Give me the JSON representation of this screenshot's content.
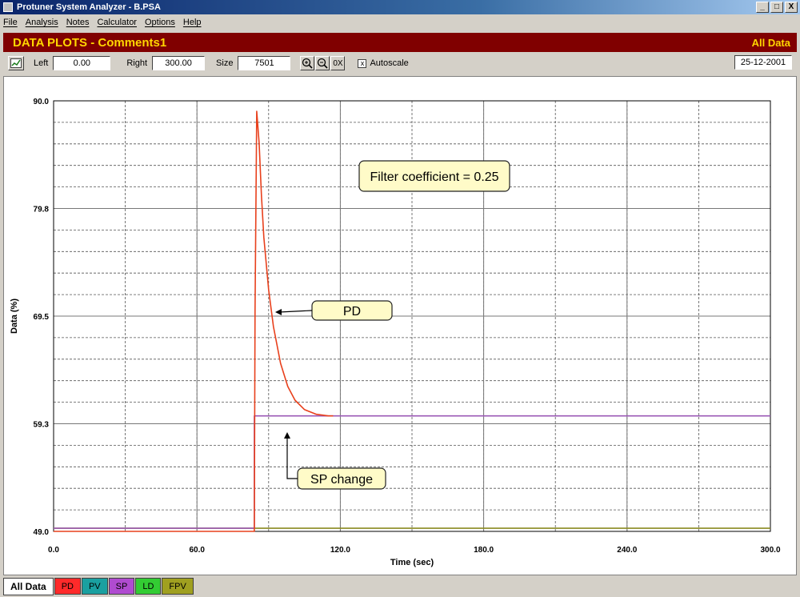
{
  "window": {
    "title": "Protuner System Analyzer - B.PSA",
    "min": "_",
    "max": "□",
    "close": "X"
  },
  "menu": [
    "File",
    "Analysis",
    "Notes",
    "Calculator",
    "Options",
    "Help"
  ],
  "header": {
    "title": "DATA PLOTS - Comments1",
    "right": "All Data"
  },
  "toolbar": {
    "left_label": "Left",
    "left_value": "0.00",
    "right_label": "Right",
    "right_value": "300.00",
    "size_label": "Size",
    "size_value": "7501",
    "zoom_in": "+",
    "zoom_out": "−",
    "zoom_reset": "0X",
    "autoscale_label": "Autoscale",
    "autoscale_checked": "x",
    "date": "25-12-2001"
  },
  "chart_data": {
    "type": "line",
    "xlabel": "Time (sec)",
    "ylabel": "Data (%)",
    "xlim": [
      0,
      300
    ],
    "ylim": [
      49.0,
      90.0
    ],
    "xticks": [
      "0.0",
      "60.0",
      "120.0",
      "180.0",
      "240.0",
      "300.0"
    ],
    "yticks": [
      "49.0",
      "59.3",
      "69.5",
      "79.8",
      "90.0"
    ],
    "grid": true,
    "series": [
      {
        "name": "PD",
        "color": "#e8401c",
        "x": [
          0,
          84,
          84.3,
          85,
          86,
          87,
          88,
          90,
          92,
          95,
          98,
          101,
          105,
          110,
          115,
          117
        ],
        "y": [
          49.0,
          49.0,
          70.0,
          89.0,
          86.0,
          81.0,
          77.0,
          72.0,
          68.5,
          65.0,
          62.8,
          61.5,
          60.6,
          60.15,
          60.0,
          60.0
        ]
      },
      {
        "name": "SP",
        "color": "#9b59b6",
        "x": [
          0,
          84,
          84,
          300
        ],
        "y": [
          49.3,
          49.3,
          60.0,
          60.0
        ]
      },
      {
        "name": "LD",
        "color": "#8a8a20",
        "x": [
          0,
          300
        ],
        "y": [
          49.3,
          49.3
        ]
      }
    ],
    "annotations": [
      {
        "text": "Filter coefficient = 0.25"
      },
      {
        "text": "PD"
      },
      {
        "text": "SP change"
      }
    ]
  },
  "tabs": [
    {
      "label": "All Data",
      "color": "#ffffff"
    },
    {
      "label": "PD",
      "color": "#ff2a2a"
    },
    {
      "label": "PV",
      "color": "#1aa0a0"
    },
    {
      "label": "SP",
      "color": "#b04bd0"
    },
    {
      "label": "LD",
      "color": "#33cc33"
    },
    {
      "label": "FPV",
      "color": "#a0a020"
    }
  ]
}
